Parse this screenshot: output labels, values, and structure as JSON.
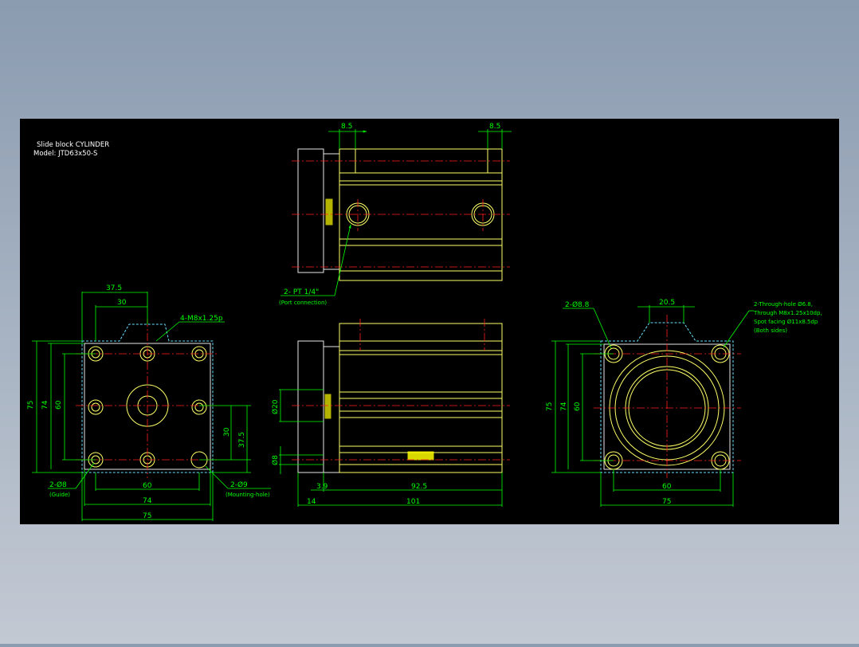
{
  "title": {
    "line1": "Slide block CYLINDER",
    "line2": "Model: JTD63x50-S"
  },
  "top_view": {
    "dim_left": "8.5",
    "dim_right": "8.5",
    "port_label": "2- PT 1/4\"",
    "port_note": "(Port connection)"
  },
  "left_view": {
    "dim_top_outer": "37.5",
    "dim_top_inner": "30",
    "thread_label": "4-M8x1.25p",
    "dim_h75": "75",
    "dim_h74": "74",
    "dim_h60": "60",
    "dim_r30": "30",
    "dim_r37_5": "37.5",
    "guide_label": "2-Ø8",
    "guide_note": "(Guide)",
    "mount_label": "2-Ø9",
    "mount_note": "(Mounting-hole)",
    "dim_b60": "60",
    "dim_b74": "74",
    "dim_b75": "75"
  },
  "front_view": {
    "dim_d20": "Ø20",
    "dim_d8": "Ø8",
    "dim_3_9": "3.9",
    "dim_92_5": "92.5",
    "dim_14": "14",
    "dim_101": "101"
  },
  "right_view": {
    "hole_label": "2-Ø8.8",
    "dim_top": "20.5",
    "note1": "2-Through-hole Ø6.8,",
    "note2": "Through M8x1.25x10dp,",
    "note3": "Spot facing Ø11x8.5dp",
    "note4": "(Both sides)",
    "dim_h75": "75",
    "dim_h74": "74",
    "dim_h60": "60",
    "dim_b60": "60",
    "dim_b75": "75"
  }
}
